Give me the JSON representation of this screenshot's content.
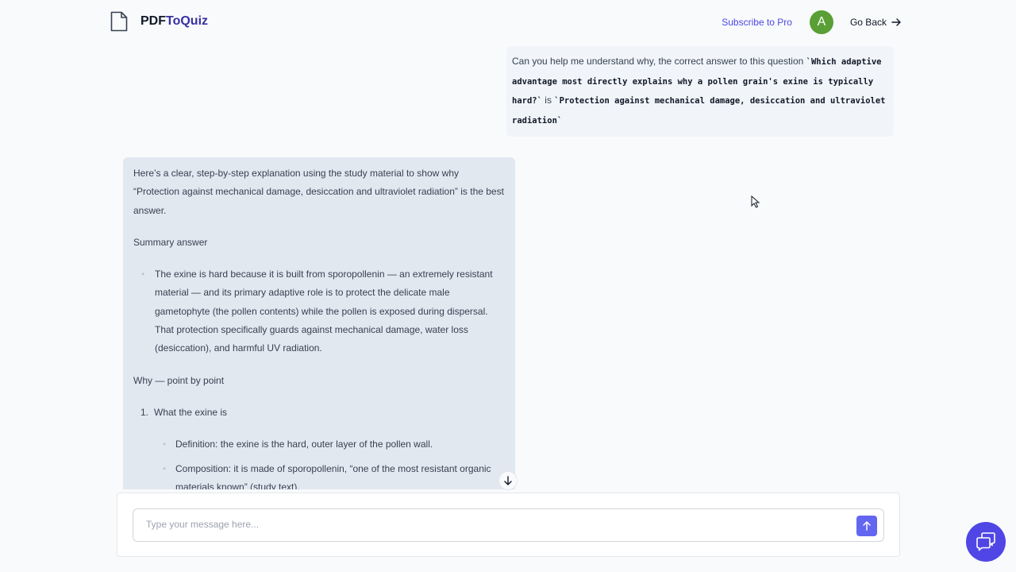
{
  "header": {
    "logo_prefix": "PDF",
    "logo_accent": "ToQuiz",
    "subscribe_label": "Subscribe to Pro",
    "avatar_initial": "A",
    "go_back_label": "Go Back",
    "avatar_color": "#5a9f35",
    "accent_color": "#4f46e5"
  },
  "user_message": {
    "text_1": "Can you help me understand why, the correct answer to this question ",
    "question_code": "`Which adaptive advantage most directly explains why a pollen grain's exine is typically hard?`",
    "text_2": " is ",
    "answer_code": "`Protection against mechanical damage, desiccation and ultraviolet radiation`"
  },
  "bot_message": {
    "intro": "Here’s a clear, step-by-step explanation using the study material to show why “Protection against mechanical damage, desiccation and ultraviolet radiation” is the best answer.",
    "summary_heading": "Summary answer",
    "summary_bullet": "The exine is hard because it is built from sporopollenin — an extremely resistant material — and its primary adaptive role is to protect the delicate male gametophyte (the pollen contents) while the pollen is exposed during dispersal. That protection specifically guards against mechanical damage, water loss (desiccation), and harmful UV radiation.",
    "why_heading": "Why — point by point",
    "points": [
      {
        "number": "1.",
        "title": "What the exine is",
        "subpoints": [
          "Definition: the exine is the hard, outer layer of the pollen wall.",
          "Composition: it is made of sporopollenin, “one of the most resistant organic materials known” (study text)."
        ]
      }
    ]
  },
  "input": {
    "placeholder": "Type your message here..."
  },
  "icons": {
    "logo": "document-icon",
    "go_back": "arrow-right-icon",
    "scroll": "arrow-down-icon",
    "send": "arrow-up-icon",
    "help": "chat-bubbles-icon"
  }
}
